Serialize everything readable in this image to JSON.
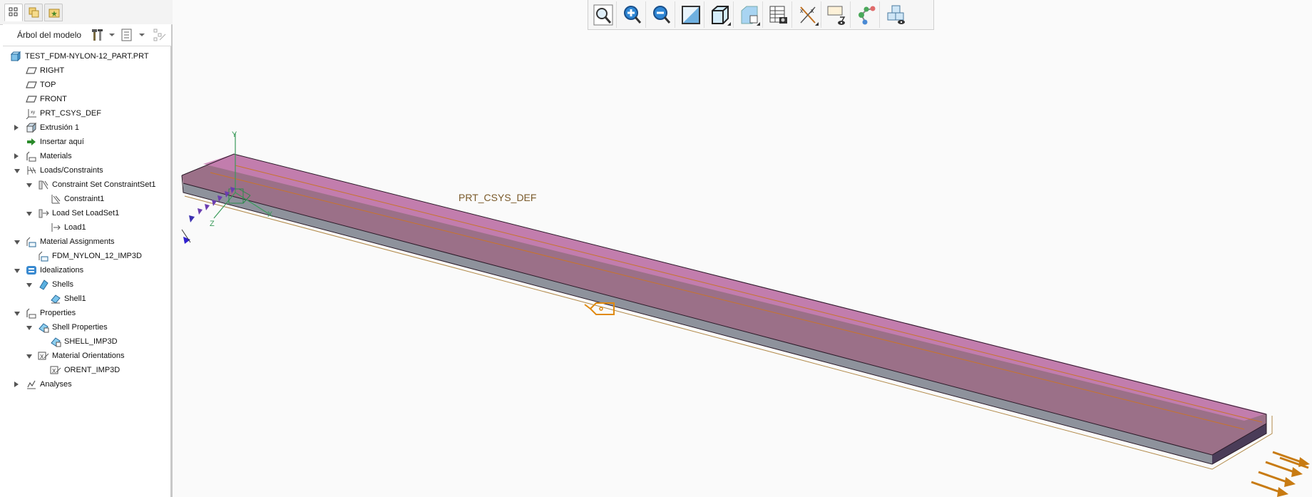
{
  "panel": {
    "tree_title": "Árbol del modelo"
  },
  "tree": [
    {
      "label": "TEST_FDM-NYLON-12_PART.PRT",
      "icon": "part-icon",
      "level": 0,
      "toggle": "none"
    },
    {
      "label": "RIGHT",
      "icon": "datum-plane-icon",
      "level": 1,
      "toggle": "none"
    },
    {
      "label": "TOP",
      "icon": "datum-plane-icon",
      "level": 1,
      "toggle": "none"
    },
    {
      "label": "FRONT",
      "icon": "datum-plane-icon",
      "level": 1,
      "toggle": "none"
    },
    {
      "label": "PRT_CSYS_DEF",
      "icon": "csys-icon",
      "level": 1,
      "toggle": "none"
    },
    {
      "label": "Extrusión 1",
      "icon": "extrude-icon",
      "level": 1,
      "toggle": "collapsed"
    },
    {
      "label": "Insertar aquí",
      "icon": "insert-arrow-icon",
      "level": 1,
      "toggle": "none"
    },
    {
      "label": "Materials",
      "icon": "materials-icon",
      "level": 1,
      "toggle": "collapsed"
    },
    {
      "label": "Loads/Constraints",
      "icon": "loads-constraints-icon",
      "level": 1,
      "toggle": "expanded"
    },
    {
      "label": "Constraint Set ConstraintSet1",
      "icon": "constraint-set-icon",
      "level": 2,
      "toggle": "expanded"
    },
    {
      "label": "Constraint1",
      "icon": "constraint-icon",
      "level": 3,
      "toggle": "none"
    },
    {
      "label": "Load Set LoadSet1",
      "icon": "load-set-icon",
      "level": 2,
      "toggle": "expanded"
    },
    {
      "label": "Load1",
      "icon": "load-icon",
      "level": 3,
      "toggle": "none"
    },
    {
      "label": "Material Assignments",
      "icon": "material-assignment-icon",
      "level": 1,
      "toggle": "expanded"
    },
    {
      "label": "FDM_NYLON_12_IMP3D",
      "icon": "material-assignment-icon",
      "level": 2,
      "toggle": "none"
    },
    {
      "label": "Idealizations",
      "icon": "idealizations-icon",
      "level": 1,
      "toggle": "expanded"
    },
    {
      "label": "Shells",
      "icon": "shells-icon",
      "level": 2,
      "toggle": "expanded"
    },
    {
      "label": "Shell1",
      "icon": "shell-icon",
      "level": 3,
      "toggle": "none"
    },
    {
      "label": "Properties",
      "icon": "properties-icon",
      "level": 1,
      "toggle": "expanded"
    },
    {
      "label": "Shell Properties",
      "icon": "shell-properties-icon",
      "level": 2,
      "toggle": "expanded"
    },
    {
      "label": "SHELL_IMP3D",
      "icon": "shell-properties-icon",
      "level": 3,
      "toggle": "none"
    },
    {
      "label": "Material Orientations",
      "icon": "material-orientation-icon",
      "level": 2,
      "toggle": "expanded"
    },
    {
      "label": "ORENT_IMP3D",
      "icon": "material-orientation-icon",
      "level": 3,
      "toggle": "none"
    },
    {
      "label": "Analyses",
      "icon": "analyses-icon",
      "level": 1,
      "toggle": "collapsed"
    }
  ],
  "toolbar": {
    "buttons": [
      "refit-icon",
      "zoom-in-icon",
      "zoom-out-icon",
      "repaint-icon",
      "display-style-icon",
      "saved-orientations-icon",
      "view-manager-icon",
      "datum-display-icon",
      "annotation-display-icon",
      "spin-center-icon",
      "simulation-display-icon"
    ]
  },
  "viewport": {
    "csys_label": "PRT_CSYS_DEF",
    "axis_y": "Y",
    "axis_x": "X",
    "axis_z": "Z",
    "colors": {
      "beam_top": "#9b7088",
      "beam_edge_top": "#c77db0",
      "beam_side": "#8a8e99",
      "load_arrow": "#c87b12",
      "constraint": "#5a3db0"
    }
  }
}
